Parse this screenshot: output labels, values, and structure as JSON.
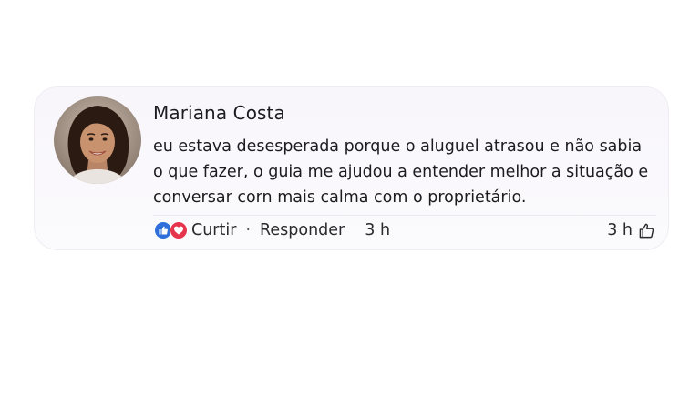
{
  "comment": {
    "author": "Mariana Costa",
    "text": "eu estava desesperada porque o aluguel atrasou e não sabia o que fazer, o guia me ajudou a entender melhor a situação e conversar corn mais calma com o proprietário.",
    "reactions": [
      "like-icon",
      "love-icon"
    ],
    "like_label": "Curtir",
    "separator": "·",
    "reply_label": "Responder",
    "time": "3 h",
    "time_right": "3 h",
    "colors": {
      "like": "#2f6fd9",
      "love": "#e5354c"
    }
  }
}
